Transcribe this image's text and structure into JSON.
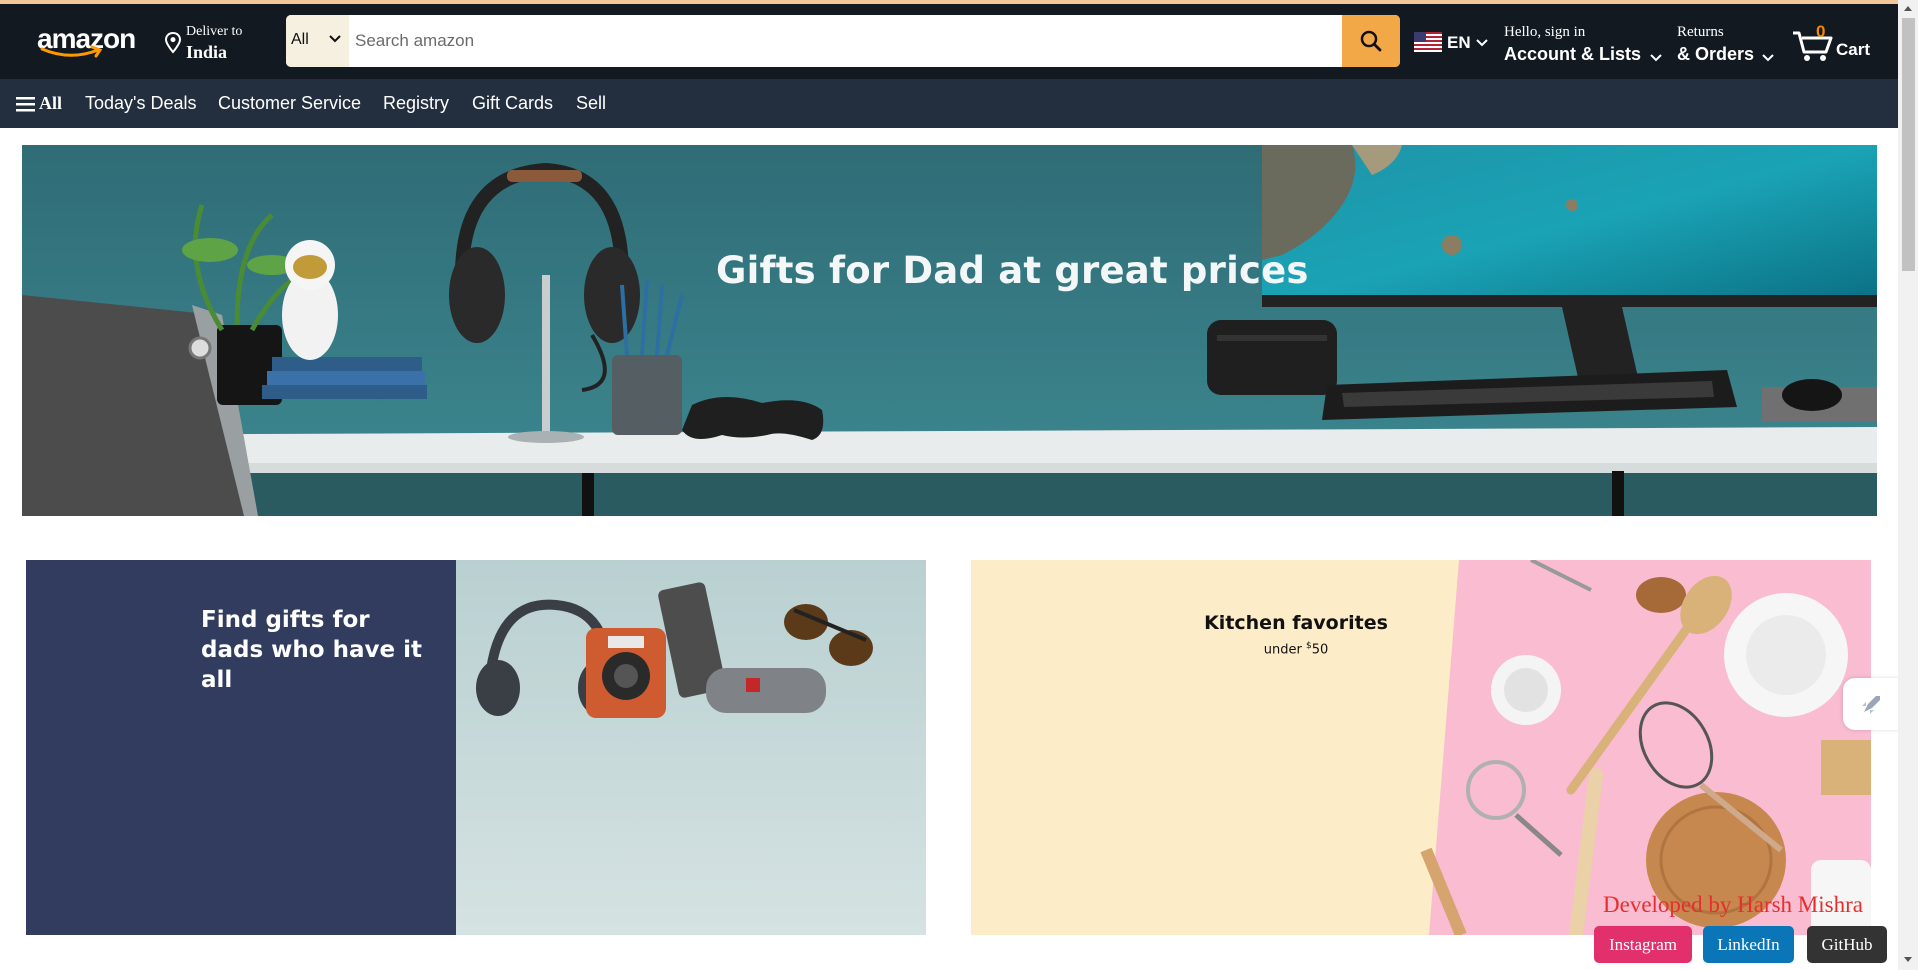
{
  "header": {
    "logo_text": "amazon",
    "deliver_line1": "Deliver to",
    "deliver_line2": "India",
    "search": {
      "category": "All",
      "placeholder": "Search amazon"
    },
    "language": "EN",
    "account_line1": "Hello, sign in",
    "account_line2": "Account & Lists",
    "returns_line1": "Returns",
    "returns_line2": "& Orders",
    "cart_count": "0",
    "cart_label": "Cart"
  },
  "subnav": {
    "all_label": "All",
    "items": [
      "Today's Deals",
      "Customer Service",
      "Registry",
      "Gift Cards",
      "Sell"
    ]
  },
  "hero": {
    "title": "Gifts for Dad at great prices"
  },
  "cards": [
    {
      "title_line1": "Find gifts for",
      "title_line2": "dads who have it all"
    },
    {
      "title": "Kitchen favorites",
      "subtitle_prefix": "under ",
      "subtitle_currency": "$",
      "subtitle_amount": "50"
    }
  ],
  "footer": {
    "developer": "Developed by Harsh Mishra",
    "links": [
      "Instagram",
      "LinkedIn",
      "GitHub"
    ]
  },
  "colors": {
    "header_bg": "#131921",
    "subnav_bg": "#232f3e",
    "search_button": "#f3a847",
    "cart_count": "#f08804",
    "instagram": "#e1306c",
    "linkedin": "#0a76b7",
    "github": "#333333"
  }
}
